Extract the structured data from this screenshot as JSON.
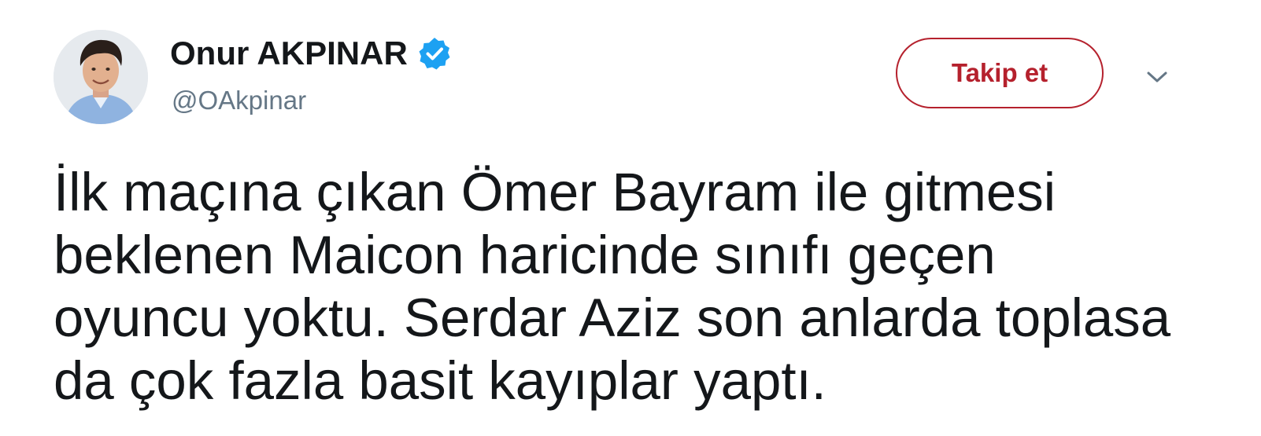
{
  "author": {
    "name": "Onur AKPINAR",
    "handle": "@OAkpinar",
    "verified_icon": "verified-badge-icon",
    "avatar_icon": "profile-photo"
  },
  "actions": {
    "follow_label": "Takip et",
    "more_icon": "chevron-down-icon"
  },
  "tweet": {
    "lines": [
      "İlk maçına çıkan Ömer Bayram ile gitmesi",
      "beklenen Maicon haricinde sınıfı geçen",
      "oyuncu yoktu. Serdar Aziz son anlarda toplasa",
      "da çok fazla basit kayıplar yaptı."
    ]
  },
  "colors": {
    "follow_accent": "#b5212d",
    "verified_blue": "#1da1f2",
    "text": "#14171a",
    "muted": "#657786"
  }
}
